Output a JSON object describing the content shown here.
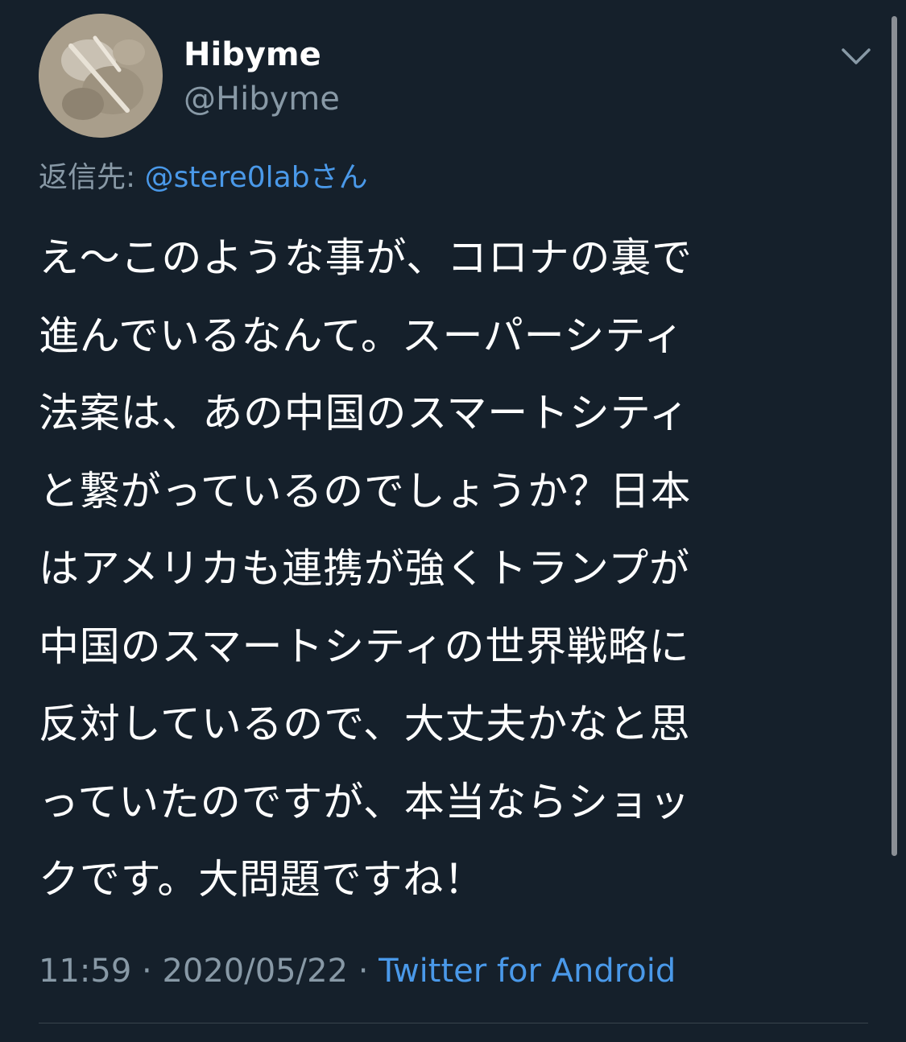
{
  "user": {
    "display_name": "Hibyme",
    "handle": "@Hibyme"
  },
  "reply": {
    "label": "返信先: ",
    "to_user": "@stere0labさん"
  },
  "tweet": {
    "lines": [
      "え～このような事が、コロナの裏で",
      "進んでいるなんて。スーパーシティ",
      "法案は、あの中国のスマートシティ",
      "と繋がっているのでしょうか？日本",
      "はアメリカも連携が強くトランプが",
      "中国のスマートシティの世界戦略に",
      "反対しているので、大丈夫かなと思",
      "っていたのですが、本当ならショッ",
      "クです。大問題ですね！"
    ]
  },
  "meta": {
    "time": "11:59",
    "separator": " · ",
    "date": "2020/05/22",
    "source": "Twitter for Android"
  },
  "icons": {
    "menu": "chevron-down-icon"
  },
  "colors": {
    "background": "#15202b",
    "text": "#ffffff",
    "muted": "#8899a6",
    "link": "#4a99e9",
    "divider": "#38444d"
  }
}
